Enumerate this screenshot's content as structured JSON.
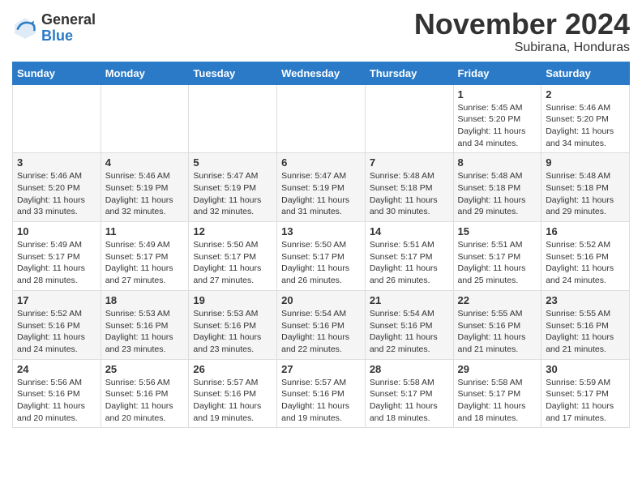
{
  "header": {
    "logo": {
      "general": "General",
      "blue": "Blue"
    },
    "title": "November 2024",
    "subtitle": "Subirana, Honduras"
  },
  "weekdays": [
    "Sunday",
    "Monday",
    "Tuesday",
    "Wednesday",
    "Thursday",
    "Friday",
    "Saturday"
  ],
  "weeks": [
    [
      {
        "day": "",
        "info": ""
      },
      {
        "day": "",
        "info": ""
      },
      {
        "day": "",
        "info": ""
      },
      {
        "day": "",
        "info": ""
      },
      {
        "day": "",
        "info": ""
      },
      {
        "day": "1",
        "info": "Sunrise: 5:45 AM\nSunset: 5:20 PM\nDaylight: 11 hours\nand 34 minutes."
      },
      {
        "day": "2",
        "info": "Sunrise: 5:46 AM\nSunset: 5:20 PM\nDaylight: 11 hours\nand 34 minutes."
      }
    ],
    [
      {
        "day": "3",
        "info": "Sunrise: 5:46 AM\nSunset: 5:20 PM\nDaylight: 11 hours\nand 33 minutes."
      },
      {
        "day": "4",
        "info": "Sunrise: 5:46 AM\nSunset: 5:19 PM\nDaylight: 11 hours\nand 32 minutes."
      },
      {
        "day": "5",
        "info": "Sunrise: 5:47 AM\nSunset: 5:19 PM\nDaylight: 11 hours\nand 32 minutes."
      },
      {
        "day": "6",
        "info": "Sunrise: 5:47 AM\nSunset: 5:19 PM\nDaylight: 11 hours\nand 31 minutes."
      },
      {
        "day": "7",
        "info": "Sunrise: 5:48 AM\nSunset: 5:18 PM\nDaylight: 11 hours\nand 30 minutes."
      },
      {
        "day": "8",
        "info": "Sunrise: 5:48 AM\nSunset: 5:18 PM\nDaylight: 11 hours\nand 29 minutes."
      },
      {
        "day": "9",
        "info": "Sunrise: 5:48 AM\nSunset: 5:18 PM\nDaylight: 11 hours\nand 29 minutes."
      }
    ],
    [
      {
        "day": "10",
        "info": "Sunrise: 5:49 AM\nSunset: 5:17 PM\nDaylight: 11 hours\nand 28 minutes."
      },
      {
        "day": "11",
        "info": "Sunrise: 5:49 AM\nSunset: 5:17 PM\nDaylight: 11 hours\nand 27 minutes."
      },
      {
        "day": "12",
        "info": "Sunrise: 5:50 AM\nSunset: 5:17 PM\nDaylight: 11 hours\nand 27 minutes."
      },
      {
        "day": "13",
        "info": "Sunrise: 5:50 AM\nSunset: 5:17 PM\nDaylight: 11 hours\nand 26 minutes."
      },
      {
        "day": "14",
        "info": "Sunrise: 5:51 AM\nSunset: 5:17 PM\nDaylight: 11 hours\nand 26 minutes."
      },
      {
        "day": "15",
        "info": "Sunrise: 5:51 AM\nSunset: 5:17 PM\nDaylight: 11 hours\nand 25 minutes."
      },
      {
        "day": "16",
        "info": "Sunrise: 5:52 AM\nSunset: 5:16 PM\nDaylight: 11 hours\nand 24 minutes."
      }
    ],
    [
      {
        "day": "17",
        "info": "Sunrise: 5:52 AM\nSunset: 5:16 PM\nDaylight: 11 hours\nand 24 minutes."
      },
      {
        "day": "18",
        "info": "Sunrise: 5:53 AM\nSunset: 5:16 PM\nDaylight: 11 hours\nand 23 minutes."
      },
      {
        "day": "19",
        "info": "Sunrise: 5:53 AM\nSunset: 5:16 PM\nDaylight: 11 hours\nand 23 minutes."
      },
      {
        "day": "20",
        "info": "Sunrise: 5:54 AM\nSunset: 5:16 PM\nDaylight: 11 hours\nand 22 minutes."
      },
      {
        "day": "21",
        "info": "Sunrise: 5:54 AM\nSunset: 5:16 PM\nDaylight: 11 hours\nand 22 minutes."
      },
      {
        "day": "22",
        "info": "Sunrise: 5:55 AM\nSunset: 5:16 PM\nDaylight: 11 hours\nand 21 minutes."
      },
      {
        "day": "23",
        "info": "Sunrise: 5:55 AM\nSunset: 5:16 PM\nDaylight: 11 hours\nand 21 minutes."
      }
    ],
    [
      {
        "day": "24",
        "info": "Sunrise: 5:56 AM\nSunset: 5:16 PM\nDaylight: 11 hours\nand 20 minutes."
      },
      {
        "day": "25",
        "info": "Sunrise: 5:56 AM\nSunset: 5:16 PM\nDaylight: 11 hours\nand 20 minutes."
      },
      {
        "day": "26",
        "info": "Sunrise: 5:57 AM\nSunset: 5:16 PM\nDaylight: 11 hours\nand 19 minutes."
      },
      {
        "day": "27",
        "info": "Sunrise: 5:57 AM\nSunset: 5:16 PM\nDaylight: 11 hours\nand 19 minutes."
      },
      {
        "day": "28",
        "info": "Sunrise: 5:58 AM\nSunset: 5:17 PM\nDaylight: 11 hours\nand 18 minutes."
      },
      {
        "day": "29",
        "info": "Sunrise: 5:58 AM\nSunset: 5:17 PM\nDaylight: 11 hours\nand 18 minutes."
      },
      {
        "day": "30",
        "info": "Sunrise: 5:59 AM\nSunset: 5:17 PM\nDaylight: 11 hours\nand 17 minutes."
      }
    ]
  ]
}
